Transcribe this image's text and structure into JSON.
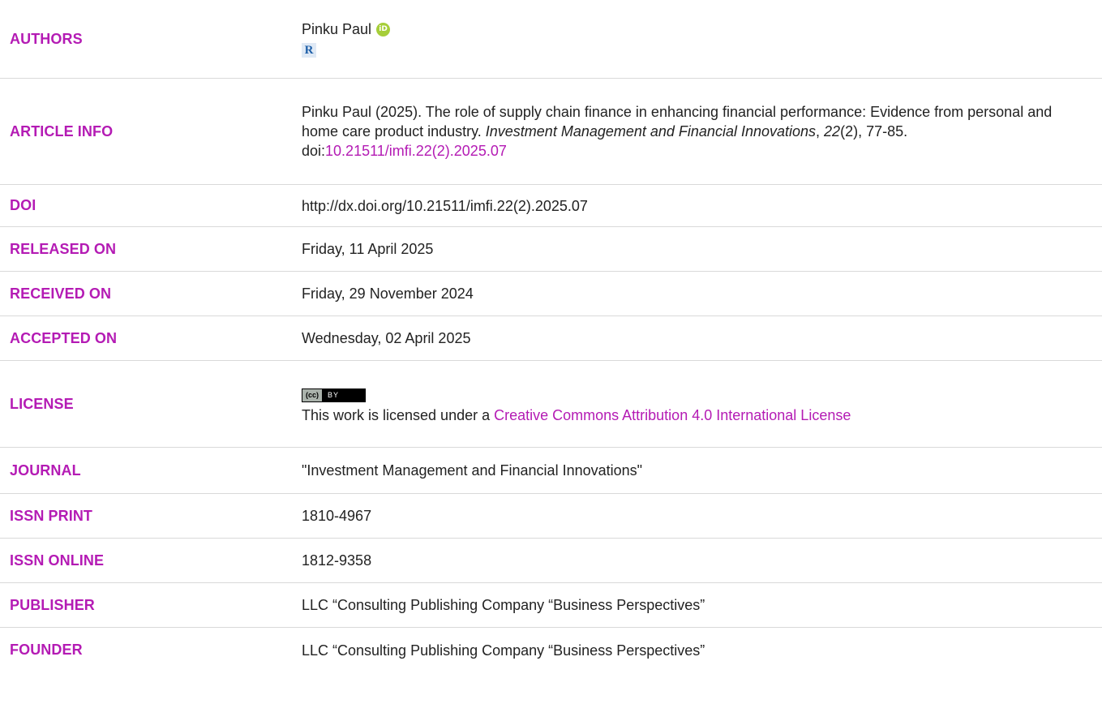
{
  "rows": {
    "authors": {
      "label": "AUTHORS",
      "name": "Pinku Paul",
      "orcid_icon": "orcid-icon",
      "researcherid_icon": "researcherid-icon",
      "orcid_glyph": "iD",
      "researcherid_glyph": "R"
    },
    "article_info": {
      "label": "ARTICLE INFO",
      "citation_start": "Pinku Paul (2025). The role of supply chain finance in enhancing financial performance: Evidence from personal and home care product industry. ",
      "journal_italic": "Investment Management and Financial Innovations",
      "comma": ", ",
      "volume_italic": "22",
      "issue_pages": "(2), 77-85.",
      "doi_prefix": "doi:",
      "doi_link": "10.21511/imfi.22(2).2025.07"
    },
    "doi": {
      "label": "DOI",
      "value": "http://dx.doi.org/10.21511/imfi.22(2).2025.07"
    },
    "released_on": {
      "label": "RELEASED ON",
      "value": "Friday, 11 April 2025"
    },
    "received_on": {
      "label": "RECEIVED ON",
      "value": "Friday, 29 November 2024"
    },
    "accepted_on": {
      "label": "ACCEPTED ON",
      "value": "Wednesday, 02 April 2025"
    },
    "license": {
      "label": "LICENSE",
      "badge_cc": "(cc)",
      "badge_by": "BY",
      "text_start": "This work is licensed under a ",
      "link_text": "Creative Commons Attribution 4.0 International License"
    },
    "journal": {
      "label": "JOURNAL",
      "value": "\"Investment Management and Financial Innovations\""
    },
    "issn_print": {
      "label": "ISSN PRINT",
      "value": "1810-4967"
    },
    "issn_online": {
      "label": "ISSN ONLINE",
      "value": "1812-9358"
    },
    "publisher": {
      "label": "PUBLISHER",
      "value": "LLC “Consulting Publishing Company “Business Perspectives”"
    },
    "founder": {
      "label": "FOUNDER",
      "value": "LLC “Consulting Publishing Company “Business Perspectives”"
    }
  },
  "colors": {
    "label_magenta": "#b41bb4",
    "text": "#222222",
    "divider": "#d9d9d9"
  }
}
